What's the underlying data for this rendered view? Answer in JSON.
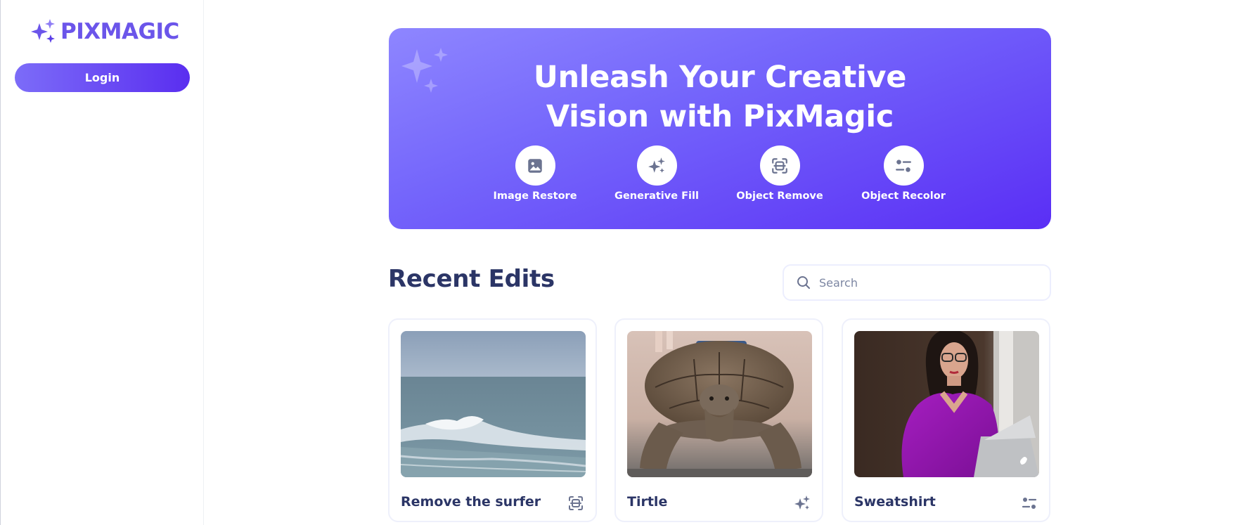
{
  "brand": {
    "name": "PIXMAGIC",
    "accent": "#6b55ea",
    "gradient_start": "#8e86ff",
    "gradient_end": "#5a2ef5"
  },
  "sidebar": {
    "login_label": "Login"
  },
  "hero": {
    "title_line1": "Unleash Your Creative",
    "title_line2": "Vision with PixMagic",
    "features": [
      {
        "label": "Image Restore",
        "icon": "image-icon"
      },
      {
        "label": "Generative Fill",
        "icon": "sparkles-icon"
      },
      {
        "label": "Object Remove",
        "icon": "scan-icon"
      },
      {
        "label": "Object Recolor",
        "icon": "sliders-icon"
      }
    ]
  },
  "recent": {
    "title": "Recent Edits",
    "search_placeholder": "Search",
    "cards": [
      {
        "title": "Remove the surfer",
        "icon": "scan-icon",
        "image": "ocean-wave"
      },
      {
        "title": "Tirtle",
        "icon": "sparkles-icon",
        "image": "tortoise"
      },
      {
        "title": "Sweatshirt",
        "icon": "sliders-icon",
        "image": "woman-purple-sweater"
      }
    ]
  }
}
